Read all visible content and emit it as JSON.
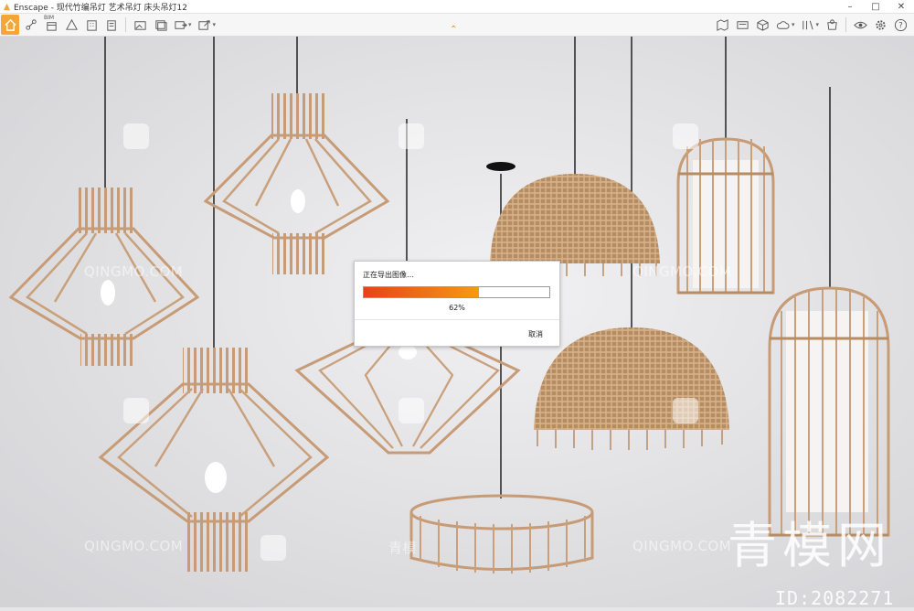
{
  "window": {
    "title": "Enscape - 现代竹编吊灯 艺术吊灯 床头吊灯12",
    "minimize": "–",
    "maximize": "□",
    "close": "✕"
  },
  "toolbar": {
    "bim_label": "BIM",
    "left_icons": [
      "home-icon",
      "settings-nodes-icon",
      "bim-icon",
      "building-icon",
      "asset-library-icon",
      "book-icon",
      "panorama-icon",
      "batch-render-icon",
      "export-icon",
      "upload-icon"
    ],
    "right_icons": [
      "map-icon",
      "video-icon",
      "cube-icon",
      "cloud-icon",
      "views-icon",
      "capture-icon",
      "eye-icon",
      "gear-icon",
      "help-icon"
    ],
    "help_label": "?"
  },
  "dialog": {
    "title": "正在导出图像…",
    "progress": 0.62,
    "progress_text": "62%",
    "cancel_label": "取消"
  },
  "watermarks": {
    "site": "QINGMO.COM",
    "site_cn": "青模",
    "big_text": "青模网",
    "id_text": "ID:2082271"
  },
  "colors": {
    "accent": "#f3a63a",
    "progress_start": "#e8421a",
    "progress_end": "#f59b10",
    "background": "#e6e6e8",
    "rattan": "#c9a07c"
  }
}
